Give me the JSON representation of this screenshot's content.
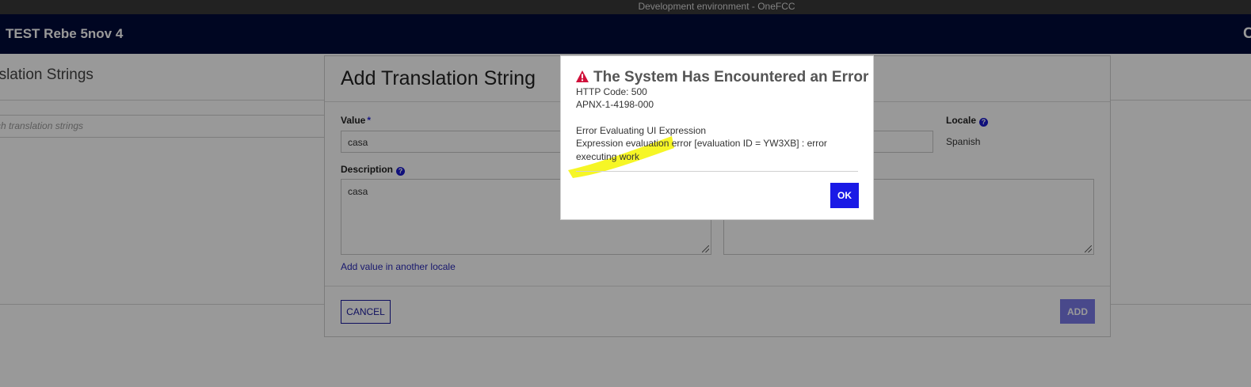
{
  "env": {
    "label": "Development environment - OneFCC"
  },
  "header": {
    "title": "TEST Rebe 5nov 4",
    "corner_glyph": "C"
  },
  "page": {
    "title": "Translation Strings",
    "title_visible": "nslation Strings",
    "search_placeholder": "rch translation strings"
  },
  "dialog": {
    "title": "Add Translation String",
    "value_label": "Value",
    "required_mark": "*",
    "value": "casa",
    "locale_label": "Locale",
    "locale_value": "Spanish",
    "description_label": "Description",
    "description_value": "casa",
    "add_locale_link": "Add value in another locale",
    "cancel_label": "CANCEL",
    "add_label": "ADD"
  },
  "error": {
    "title": "The System Has Encountered an Error",
    "http_code": "HTTP Code: 500",
    "error_code": "APNX-1-4198-000",
    "heading": "Error Evaluating UI Expression",
    "message_line1": "Expression evaluation error [evaluation ID = YW3XB] : error",
    "message_line2": "executing work",
    "ok_label": "OK"
  },
  "colors": {
    "header_bg": "#000a3a",
    "primary": "#1a1ae6",
    "warning": "#d0103a",
    "highlight": "#f5f500"
  },
  "icons": {
    "warning": "warning-icon",
    "help": "help-icon",
    "resize": "resize-grip-icon"
  }
}
